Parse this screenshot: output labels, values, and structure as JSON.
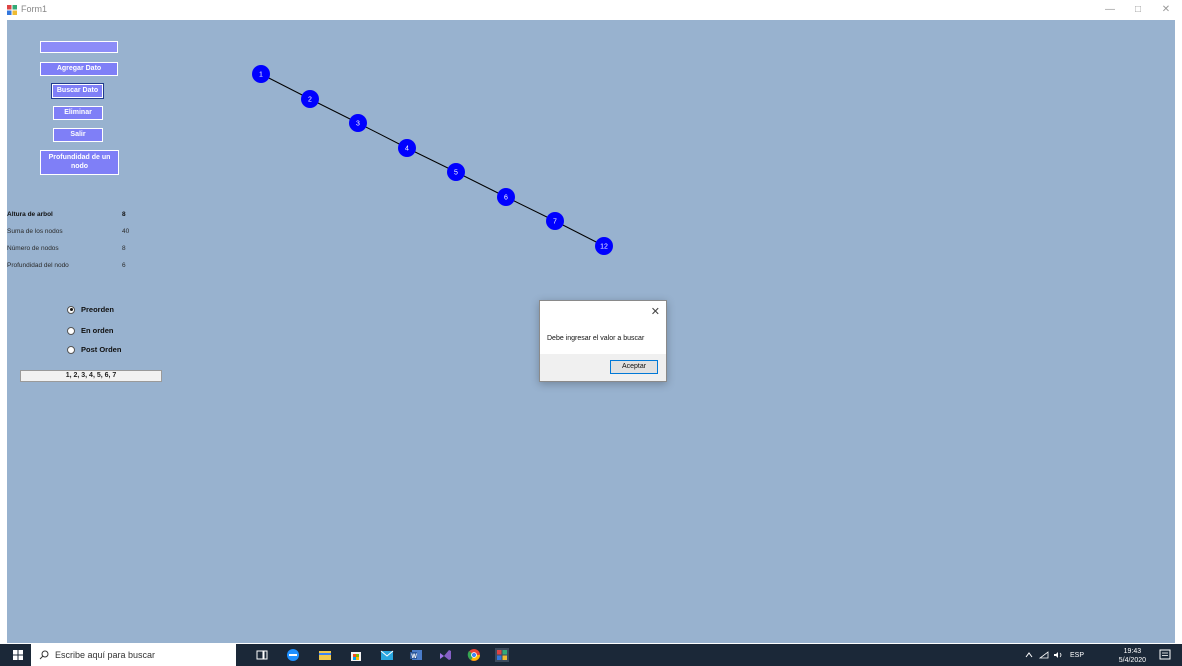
{
  "window": {
    "title": "Form1",
    "controls": [
      "—",
      "□",
      "✕"
    ]
  },
  "panel": {
    "input_value": "",
    "buttons": [
      {
        "label": "Agregar Dato"
      },
      {
        "label": "Buscar Dato"
      },
      {
        "label": "Eliminar"
      },
      {
        "label": "Salir"
      },
      {
        "label": "Profundidad de un nodo"
      }
    ],
    "stats": [
      {
        "label": "Altura de arbol",
        "value": "8"
      },
      {
        "label": "Suma de los nodos",
        "value": "40"
      },
      {
        "label": "Número de nodos",
        "value": "8"
      },
      {
        "label": "Profundidad del nodo",
        "value": "6"
      }
    ],
    "traversal": {
      "options": [
        {
          "label": "Preorden",
          "selected": true
        },
        {
          "label": "En orden",
          "selected": false
        },
        {
          "label": "Post Orden",
          "selected": false
        }
      ],
      "result": "1, 2, 3, 4, 5, 6, 7"
    }
  },
  "tree": {
    "nodes": [
      "1",
      "2",
      "3",
      "4",
      "5",
      "6",
      "7",
      "12"
    ],
    "node_color": "#0000ff",
    "edge_color": "#000000"
  },
  "dialog": {
    "message": "Debe ingresar el valor a buscar",
    "ok_label": "Aceptar",
    "close_glyph": "✕"
  },
  "taskbar": {
    "search_placeholder": "Escribe aquí para buscar",
    "tray_lang": "ESP",
    "time": "19:43",
    "date": "5/4/2020"
  },
  "colors": {
    "client_bg": "#98b2cf",
    "button_bg": "#7f7ff7",
    "taskbar_bg": "#1b2838"
  }
}
